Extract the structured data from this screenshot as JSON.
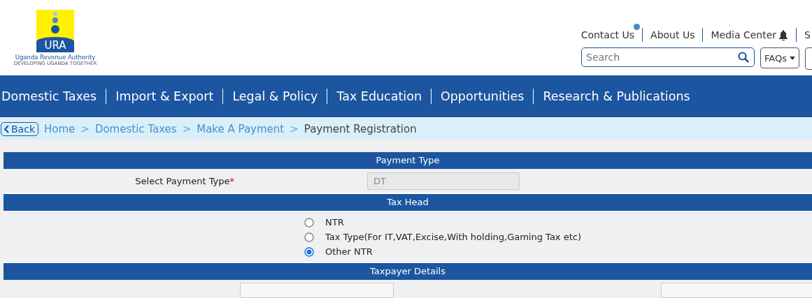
{
  "logo": {
    "mark": "URA",
    "name": "Uganda Revenue Authority",
    "tagline": "DEVELOPING UGANDA TOGETHER"
  },
  "top_links": [
    {
      "label": "Contact Us",
      "notification": true,
      "bell": false
    },
    {
      "label": "About Us",
      "notification": false,
      "bell": false
    },
    {
      "label": "Media Center",
      "notification": false,
      "bell": true
    },
    {
      "label": "S",
      "notification": false,
      "bell": false
    }
  ],
  "search": {
    "placeholder": "Search"
  },
  "faqs_button": "FAQs",
  "main_nav": [
    "Domestic Taxes",
    "Import & Export",
    "Legal & Policy",
    "Tax Education",
    "Opportunities",
    "Research & Publications"
  ],
  "back_button": "Back",
  "breadcrumb": [
    {
      "label": "Home",
      "current": false
    },
    {
      "label": "Domestic Taxes",
      "current": false
    },
    {
      "label": "Make A Payment",
      "current": false
    },
    {
      "label": "Payment Registration",
      "current": true
    }
  ],
  "breadcrumb_separator": ">",
  "sections": [
    {
      "title": "Payment Type"
    },
    {
      "title": "Tax Head"
    },
    {
      "title": "Taxpayer Details"
    }
  ],
  "payment_type": {
    "label": "Select Payment Type",
    "required_mark": "*",
    "value": "DT",
    "disabled": true
  },
  "tax_head_options": [
    {
      "label": "NTR",
      "selected": false
    },
    {
      "label": "Tax Type(For IT,VAT,Excise,With holding,Gaming Tax etc)",
      "selected": false
    },
    {
      "label": "Other NTR",
      "selected": true
    }
  ]
}
